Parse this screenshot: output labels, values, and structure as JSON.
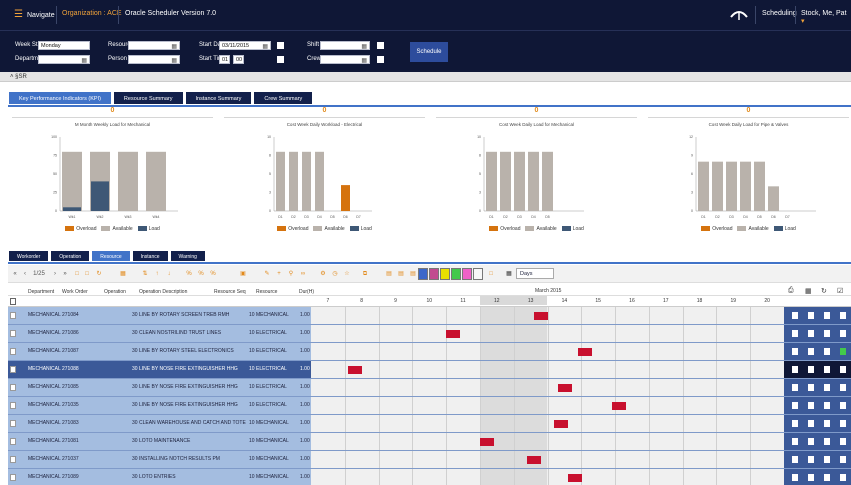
{
  "topbar": {
    "navigate": "Navigate",
    "org_label": "Organization :",
    "org_value": "ACE",
    "version": "Oracle Scheduler Version 7.0",
    "scheduling": "Scheduling",
    "user": "Stock, Me, Pat"
  },
  "form": {
    "week_start_label": "Week Start",
    "week_start_value": "Monday",
    "department_label": "Department",
    "resource_label": "Resource",
    "person_label": "Person",
    "start_date_label": "Start Date",
    "start_date_value": "03/11/2015",
    "start_time_label": "Start Time",
    "start_time_h": "01",
    "start_time_m": "00",
    "shift_label": "Shift",
    "crew_label": "Crew",
    "schedule_button": "Schedule"
  },
  "collapse_text": "˄ §SR",
  "kpi_tabs": [
    "Key Performance Indicators (KPI)",
    "Resource Summary",
    "Instance Summary",
    "Crew Summary"
  ],
  "charts": [
    {
      "num": "0",
      "title": "M Month Weekly Load for Mechanical"
    },
    {
      "num": "0",
      "title": "Cost Week Daily Workload - Electrical"
    },
    {
      "num": "0",
      "title": "Cost Week Daily Load for Mechanical"
    },
    {
      "num": "0",
      "title": "Cost Week Daily Load for Pipe & Valves"
    }
  ],
  "legend": [
    "Overload",
    "Available",
    "Load"
  ],
  "colors": {
    "overload": "#d5730e",
    "available": "#b9b2ab",
    "load": "#3e5876"
  },
  "chart_data": [
    {
      "type": "bar",
      "categories": [
        "Wk1",
        "Wk2",
        "Wk3",
        "Wk4"
      ],
      "series": [
        {
          "name": "Available",
          "values": [
            80,
            80,
            80,
            80
          ]
        },
        {
          "name": "Load",
          "values": [
            5,
            40,
            0,
            0
          ]
        },
        {
          "name": "Overload",
          "values": [
            0,
            0,
            0,
            0
          ]
        }
      ],
      "ylim": [
        0,
        100
      ]
    },
    {
      "type": "bar",
      "categories": [
        "D1",
        "D2",
        "D3",
        "D4",
        "D5",
        "D6",
        "D7"
      ],
      "series": [
        {
          "name": "Available",
          "values": [
            8,
            8,
            8,
            8,
            0,
            0,
            0
          ]
        },
        {
          "name": "Overload",
          "values": [
            0,
            0,
            0,
            0,
            0,
            3.5,
            0
          ]
        }
      ],
      "ylim": [
        0,
        10
      ]
    },
    {
      "type": "bar",
      "categories": [
        "D1",
        "D2",
        "D3",
        "D4",
        "D5"
      ],
      "series": [
        {
          "name": "Available",
          "values": [
            8,
            8,
            8,
            8,
            8
          ]
        }
      ],
      "ylim": [
        0,
        10
      ]
    },
    {
      "type": "bar",
      "categories": [
        "D1",
        "D2",
        "D3",
        "D4",
        "D5",
        "D6",
        "D7"
      ],
      "series": [
        {
          "name": "Available",
          "values": [
            8,
            8,
            8,
            8,
            8,
            4,
            0
          ]
        }
      ],
      "ylim": [
        0,
        12
      ]
    }
  ],
  "bottom_tabs": [
    "Workorder",
    "Operation",
    "Resource",
    "Instance",
    "Warning"
  ],
  "toolbar": {
    "page": "1/25",
    "view": "Days"
  },
  "grid": {
    "headers": [
      "Department",
      "Work Order",
      "Operation",
      "Operation Description",
      "Resource Seq",
      "Resource",
      "Dur(H)"
    ],
    "month": "March 2015",
    "days": [
      "7",
      "8",
      "9",
      "10",
      "11",
      "12",
      "13",
      "14",
      "15",
      "16",
      "17",
      "18",
      "19",
      "20"
    ],
    "rows": [
      {
        "dept": "MECHANICAL",
        "wo": "271084",
        "op": "30",
        "desc": "LINE BY ROTARY SCREEN TREB RMH",
        "seq": "10",
        "res": "MECHANICAL",
        "dur": "1.00",
        "day": "13.6"
      },
      {
        "dept": "MECHANICAL",
        "wo": "271086",
        "op": "30",
        "desc": "CLEAN NOSTRILIND TRUST LINES",
        "seq": "10",
        "res": "ELECTRICAL",
        "dur": "1.00",
        "day": "11"
      },
      {
        "dept": "MECHANICAL",
        "wo": "271087",
        "op": "30",
        "desc": "LINE BY ROTARY STEEL ELECTRONICS",
        "seq": "10",
        "res": "ELECTRICAL",
        "dur": "1.00",
        "day": "14.9"
      },
      {
        "dept": "MECHANICAL",
        "wo": "271088",
        "op": "30",
        "desc": "LINE BY NOSE FIRE EXTINGUISHER HHG",
        "seq": "10",
        "res": "ELECTRICAL",
        "dur": "1.00",
        "day": "8.1",
        "selected": true
      },
      {
        "dept": "MECHANICAL",
        "wo": "271085",
        "op": "30",
        "desc": "LINE BY NOSE FIRE EXTINGUISHER HHG",
        "seq": "10",
        "res": "ELECTRICAL",
        "dur": "1.00",
        "day": "14.3"
      },
      {
        "dept": "MECHANICAL",
        "wo": "271035",
        "op": "30",
        "desc": "LINE BY NOSE FIRE EXTINGUISHER HHG",
        "seq": "10",
        "res": "ELECTRICAL",
        "dur": "1.00",
        "day": "15.9"
      },
      {
        "dept": "MECHANICAL",
        "wo": "271083",
        "op": "30",
        "desc": "CLEAN WAREHOUSE AND CATCH AND TOTE",
        "seq": "10",
        "res": "MECHANICAL",
        "dur": "1.00",
        "day": "14.2"
      },
      {
        "dept": "MECHANICAL",
        "wo": "271081",
        "op": "30",
        "desc": "LOTO MAINTENANCE",
        "seq": "10",
        "res": "MECHANICAL",
        "dur": "1.00",
        "day": "12"
      },
      {
        "dept": "MECHANICAL",
        "wo": "271037",
        "op": "30",
        "desc": "INSTALLING NOTCH RESULTS PM",
        "seq": "10",
        "res": "MECHANICAL",
        "dur": "1.00",
        "day": "13.4"
      },
      {
        "dept": "MECHANICAL",
        "wo": "271089",
        "op": "30",
        "desc": "LOTO ENTRIES",
        "seq": "10",
        "res": "MECHANICAL",
        "dur": "1.00",
        "day": "14.6"
      },
      {
        "dept": "MECHANICAL",
        "wo": "271090",
        "op": "30",
        "desc": "CLEAN NOTE AND TRUST LINES",
        "seq": "10",
        "res": "MECHANICAL",
        "dur": "1.00",
        "day": "16"
      }
    ]
  }
}
